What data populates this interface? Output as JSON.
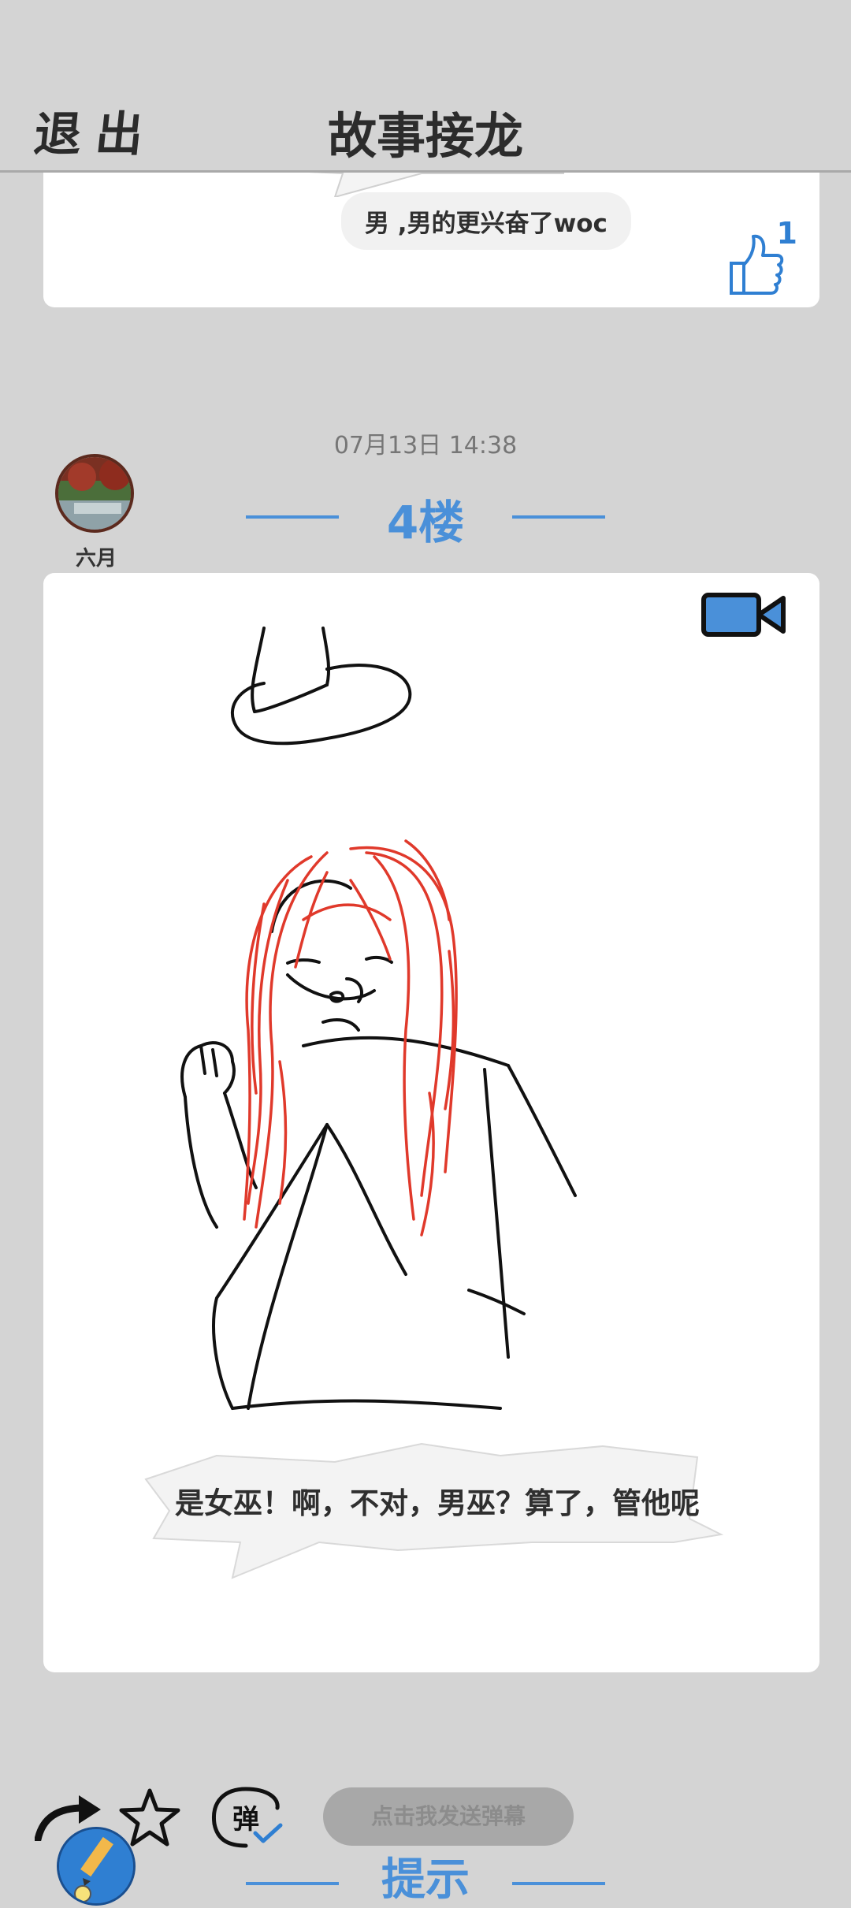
{
  "header": {
    "exit_label": "退出",
    "title": "故事接龙"
  },
  "previous_post": {
    "caption": "男 ,男的更兴奋了woc",
    "like_count": "1"
  },
  "post": {
    "timestamp": "07月13日  14:38",
    "author": "六月",
    "floor_label": "4楼",
    "caption": "是女巫！啊，不对，男巫？算了，管他呢"
  },
  "toolbar": {
    "danmaku_icon_text": "弹",
    "danmaku_placeholder": "点击我发送弹幕"
  },
  "next_section": {
    "label": "提示"
  },
  "colors": {
    "accent": "#4a90d9",
    "background": "#d4d4d4",
    "hair_red": "#e0392b"
  }
}
